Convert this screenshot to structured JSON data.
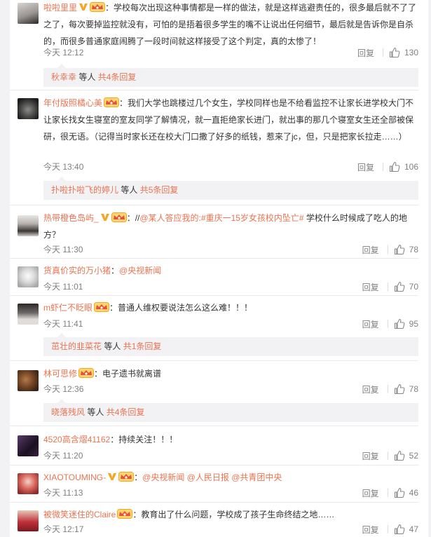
{
  "icons": [
    "avatar",
    "vip-v-icon",
    "member-crown-icon",
    "like-thumb-icon"
  ],
  "colors": {
    "name": "#eb7350",
    "muted": "#808080",
    "text": "#333333",
    "panel": "#f2f2f5"
  },
  "comments": [
    {
      "user": "啦啦里里",
      "text": "：学校每次出现这种事情都是一样的做法，就是这样逃避责任的，很多最后就不了了之了，每次要掉监控就没有，可怕的是捂着很多学生的嘴不让说出任何细节，最后就是告诉你是自杀的，而很多普通家庭闹腾了一段时间就这样接受了这个判定，真的太惨了！",
      "time": "今天 12:12",
      "reply": "回复",
      "likes": "130",
      "sub": {
        "name": "秋幸幸",
        "mid": " 等人 ",
        "count": "共4条回复"
      }
    },
    {
      "user": "年付版照橘心美",
      "text": "：我们大学也跳楼过几个女生，学校同样也是不给看监控不让家长进学校大门不让家长找女生寝室的室友同学了解情况，就一直拒绝家长进门，就出事的那几个寝室女生还全部被保研，很无语。（记得当时家长还在校大门口撒了好多的纸钱，惹来了jc，但，只是把家长拉走……）",
      "time": "今天 13:40",
      "reply": "回复",
      "likes": "106",
      "sub": {
        "name": "扑啦扑啦飞的婷儿",
        "mid": " 等人 ",
        "count": "共5条回复"
      }
    },
    {
      "user": "热带橙色岛屿_",
      "pre": "：//",
      "mention": "@某人答应我的",
      "colon": ":",
      "topic": "#重庆一15岁女孩校内坠亡#",
      "text": " 学校什么时候成了吃人的地方？",
      "time": "今天 11:30",
      "reply": "回复",
      "likes": "78"
    },
    {
      "user": "货真价实的万小猪",
      "pre": "：",
      "mention": "@央视新闻",
      "time": "今天 11:01",
      "reply": "回复",
      "likes": "70"
    },
    {
      "user": "m虾仁不眨眼",
      "text": "：普通人维权要说法怎么这么难！！！",
      "time": "今天 11:41",
      "reply": "回复",
      "likes": "95",
      "sub": {
        "name": "茁壮的韭菜花",
        "mid": " 等人 ",
        "count": "共1条回复"
      }
    },
    {
      "user": "林可思修",
      "text": "：电子遗书就离谱",
      "time": "今天 12:36",
      "reply": "回复",
      "likes": "78",
      "sub": {
        "name": "晓落残风",
        "mid": " 等人 ",
        "count": "共4条回复"
      }
    },
    {
      "user": "4520高含熠41162",
      "text": "：持续关注！！！",
      "time": "今天 11:20",
      "reply": "回复",
      "likes": "52"
    },
    {
      "user": "XIAOTOUMING-",
      "pre": "：",
      "mentions": [
        "@央视新闻",
        "@人民日报",
        "@共青团中央"
      ],
      "time": "今天 11:13",
      "reply": "回复",
      "likes": "46"
    },
    {
      "user": "被微笑迷住的Claire",
      "text": "：教育出了什么问题，学校成了孩子生命终结之地……",
      "time": "今天 12:17",
      "reply": "回复",
      "likes": "47"
    }
  ]
}
